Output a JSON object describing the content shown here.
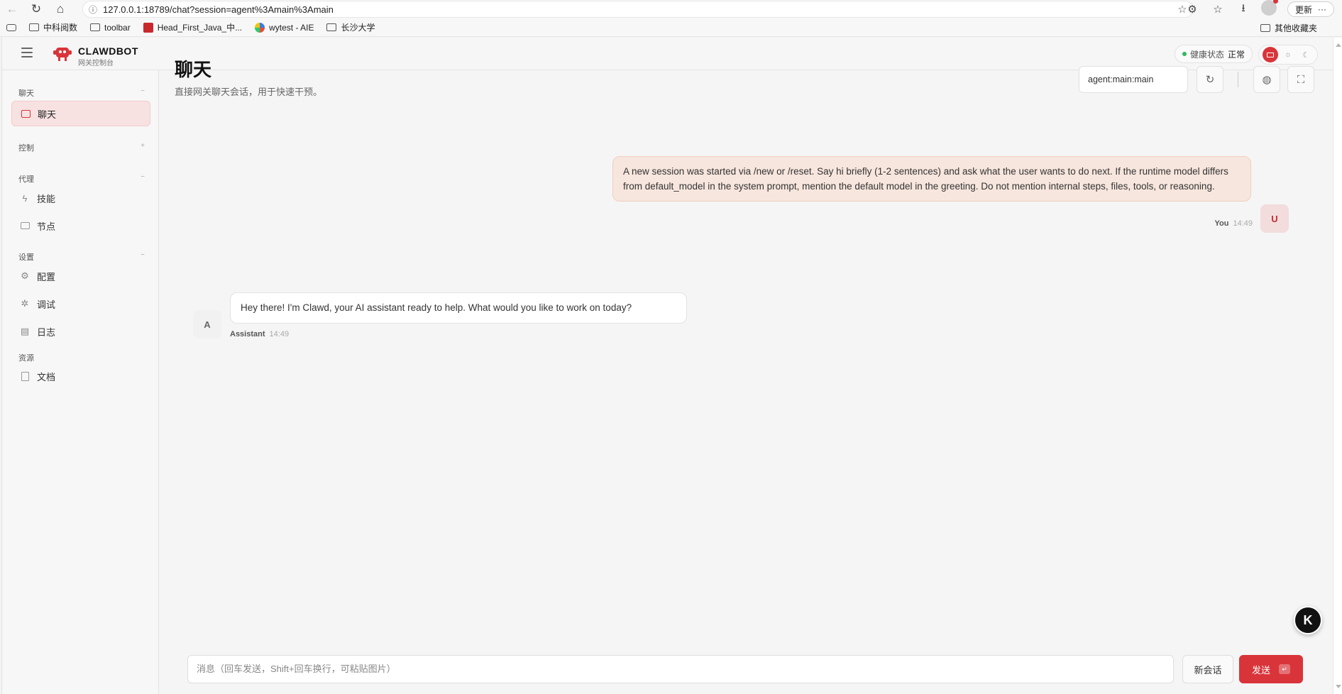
{
  "browser": {
    "url": "127.0.0.1:18789/chat?session=agent%3Amain%3Amain",
    "update_label": "更新",
    "bookmarks": [
      "中科阅数",
      "toolbar",
      "Head_First_Java_中...",
      "wytest - AIE",
      "长沙大学"
    ],
    "other_bookmarks": "其他收藏夹"
  },
  "app": {
    "brand": "CLAWDBOT",
    "brand_sub": "网关控制台",
    "health_label": "健康状态",
    "health_value": "正常",
    "accent": "#d9343a"
  },
  "sidebar": {
    "groups": [
      {
        "title": "聊天",
        "toggle": "−"
      },
      {
        "title": "控制",
        "toggle": "+"
      },
      {
        "title": "代理",
        "toggle": "−"
      },
      {
        "title": "设置",
        "toggle": "−"
      },
      {
        "title": "资源",
        "toggle": ""
      }
    ],
    "items": [
      {
        "label": "聊天",
        "icon": "chat-icon"
      },
      {
        "label": "技能",
        "icon": "bolt-icon"
      },
      {
        "label": "节点",
        "icon": "monitor-icon"
      },
      {
        "label": "配置",
        "icon": "gear-icon"
      },
      {
        "label": "调试",
        "icon": "bug-icon"
      },
      {
        "label": "日志",
        "icon": "scroll-icon"
      },
      {
        "label": "文档",
        "icon": "book-icon"
      }
    ]
  },
  "main": {
    "title": "聊天",
    "subtitle": "直接网关聊天会话，用于快速干预。",
    "session_value": "agent:main:main"
  },
  "messages": [
    {
      "role": "user",
      "avatar": "U",
      "sender": "You",
      "time": "14:49",
      "text": "A new session was started via /new or /reset. Say hi briefly (1-2 sentences) and ask what the user wants to do next. If the runtime model differs from default_model in the system prompt, mention the default model in the greeting. Do not mention internal steps, files, tools, or reasoning."
    },
    {
      "role": "assistant",
      "avatar": "A",
      "sender": "Assistant",
      "time": "14:49",
      "text": "Hey there! I'm Clawd, your AI assistant ready to help. What would you like to work on today?"
    }
  ],
  "composer": {
    "placeholder": "消息（回车发送，Shift+回车换行，可粘贴图片）",
    "new_session_label": "新会话",
    "send_label": "发送",
    "send_key": "↵"
  },
  "fab": {
    "label": "K"
  }
}
